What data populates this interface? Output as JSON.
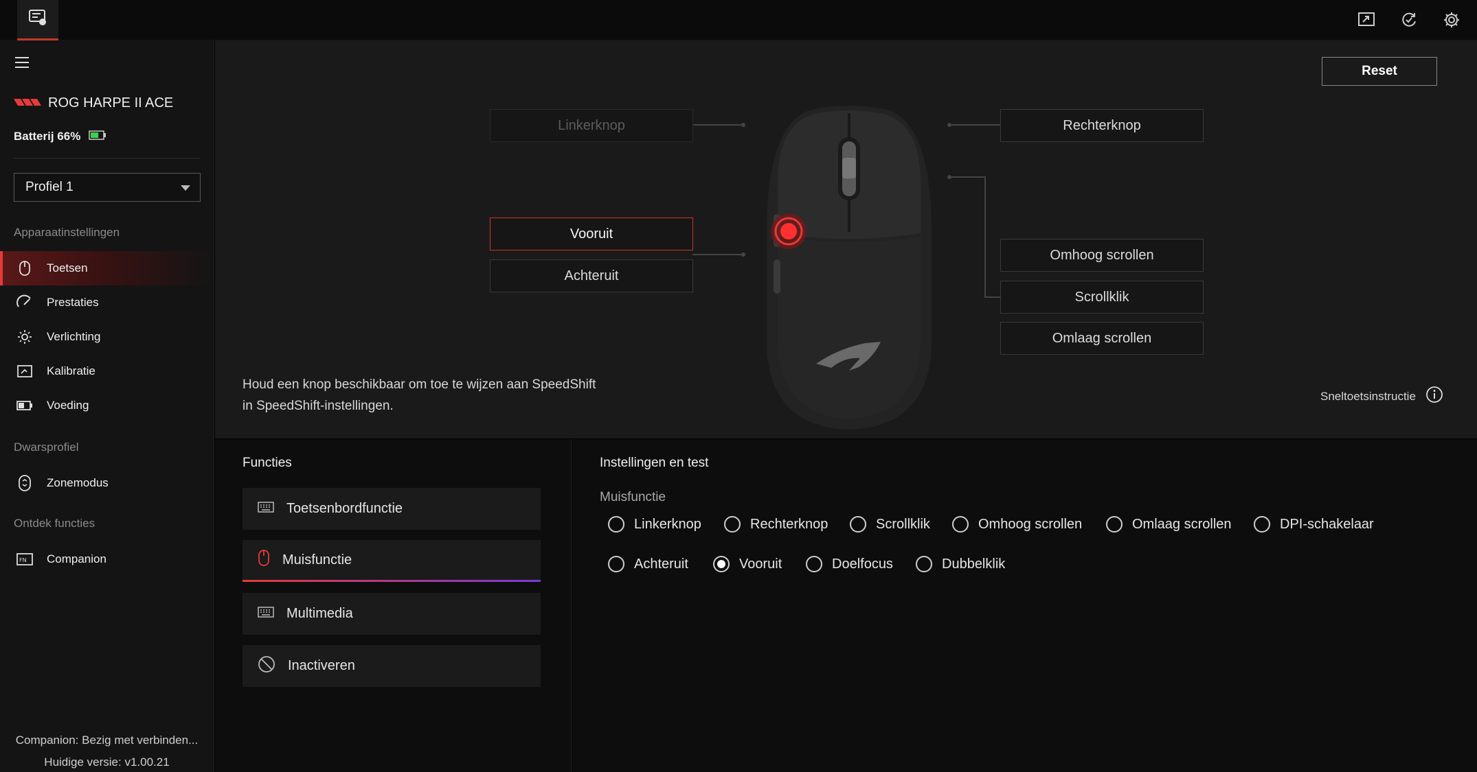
{
  "colors": {
    "accent": "#e53a3a",
    "background": "#1a1a1a",
    "sidebar": "#141414",
    "panel": "#0d0d0d",
    "button_bg": "#1b1b1b",
    "battery_green": "#3ccf4e",
    "purple_accent": "#7a3bd8"
  },
  "topbar": {
    "app_icon": "armoury-crate-icon",
    "actions": [
      {
        "name": "screen-share-icon"
      },
      {
        "name": "sync-icon"
      },
      {
        "name": "gear-icon"
      }
    ]
  },
  "sidebar": {
    "device_logo": "rog-logo-icon",
    "device_name": "ROG HARPE II ACE",
    "battery_label": "Batterij 66%",
    "battery_level": 0.66,
    "profile": "Profiel 1",
    "section_device": "Apparaatinstellingen",
    "items": [
      {
        "label": "Toetsen",
        "icon": "mouse-icon",
        "active": true
      },
      {
        "label": "Prestaties",
        "icon": "performance-icon",
        "active": false
      },
      {
        "label": "Verlichting",
        "icon": "lighting-icon",
        "active": false
      },
      {
        "label": "Kalibratie",
        "icon": "calibration-icon",
        "active": false
      },
      {
        "label": "Voeding",
        "icon": "battery-icon",
        "active": false
      }
    ],
    "section_profile": "Dwarsprofiel",
    "profile_items": [
      {
        "label": "Zonemodus",
        "icon": "zone-mode-icon"
      }
    ],
    "section_discover": "Ontdek functies",
    "discover_items": [
      {
        "label": "Companion",
        "icon": "companion-icon"
      }
    ],
    "footer_status": "Companion: Bezig met verbinden...",
    "footer_version": "Huidige versie: v1.00.21"
  },
  "mouse_view": {
    "reset_label": "Reset",
    "buttons": {
      "left": "Linkerknop",
      "right": "Rechterknop",
      "forward": "Vooruit",
      "back": "Achteruit",
      "scroll_up": "Omhoog scrollen",
      "scroll_click": "Scrollklik",
      "scroll_down": "Omlaag scrollen"
    },
    "hint": "Houd een knop beschikbaar om toe te wijzen aan SpeedShift in SpeedShift-instellingen.",
    "shortcut_help": "Sneltoetsinstructie"
  },
  "functions": {
    "title": "Functies",
    "items": [
      {
        "label": "Toetsenbordfunctie",
        "icon": "keyboard-icon",
        "active": false
      },
      {
        "label": "Muisfunctie",
        "icon": "mouse-icon",
        "active": true
      },
      {
        "label": "Multimedia",
        "icon": "multimedia-keyboard-icon",
        "active": false
      },
      {
        "label": "Inactiveren",
        "icon": "disable-icon",
        "active": false
      }
    ]
  },
  "settings": {
    "title": "Instellingen en test",
    "subtitle": "Muisfunctie",
    "options_row1": [
      {
        "label": "Linkerknop",
        "checked": false
      },
      {
        "label": "Rechterknop",
        "checked": false
      },
      {
        "label": "Scrollklik",
        "checked": false
      },
      {
        "label": "Omhoog scrollen",
        "checked": false
      },
      {
        "label": "Omlaag scrollen",
        "checked": false
      },
      {
        "label": "DPI-schakelaar",
        "checked": false
      }
    ],
    "options_row2": [
      {
        "label": "Achteruit",
        "checked": false
      },
      {
        "label": "Vooruit",
        "checked": true
      },
      {
        "label": "Doelfocus",
        "checked": false
      },
      {
        "label": "Dubbelklik",
        "checked": false
      }
    ]
  }
}
